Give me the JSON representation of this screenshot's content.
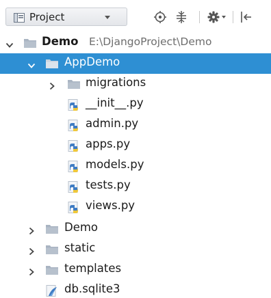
{
  "toolbar": {
    "tab_label": "Project",
    "buttons": [
      "locate-icon",
      "collapse-all-icon",
      "settings-icon",
      "hide-icon"
    ]
  },
  "tree": {
    "root": {
      "label": "Demo",
      "path": "E:\\DjangoProject\\Demo"
    },
    "appdemo": {
      "label": "AppDemo"
    },
    "migrations": {
      "label": "migrations"
    },
    "files": [
      {
        "label": "__init__.py"
      },
      {
        "label": "admin.py"
      },
      {
        "label": "apps.py"
      },
      {
        "label": "models.py"
      },
      {
        "label": "tests.py"
      },
      {
        "label": "views.py"
      }
    ],
    "folders": [
      {
        "label": "Demo"
      },
      {
        "label": "static"
      },
      {
        "label": "templates"
      }
    ],
    "db": {
      "label": "db.sqlite3"
    }
  },
  "colors": {
    "selection": "#2e8fd3",
    "folder": "#a9b4c2",
    "python_blue": "#3f7cc3",
    "python_yellow": "#f0c83a"
  }
}
